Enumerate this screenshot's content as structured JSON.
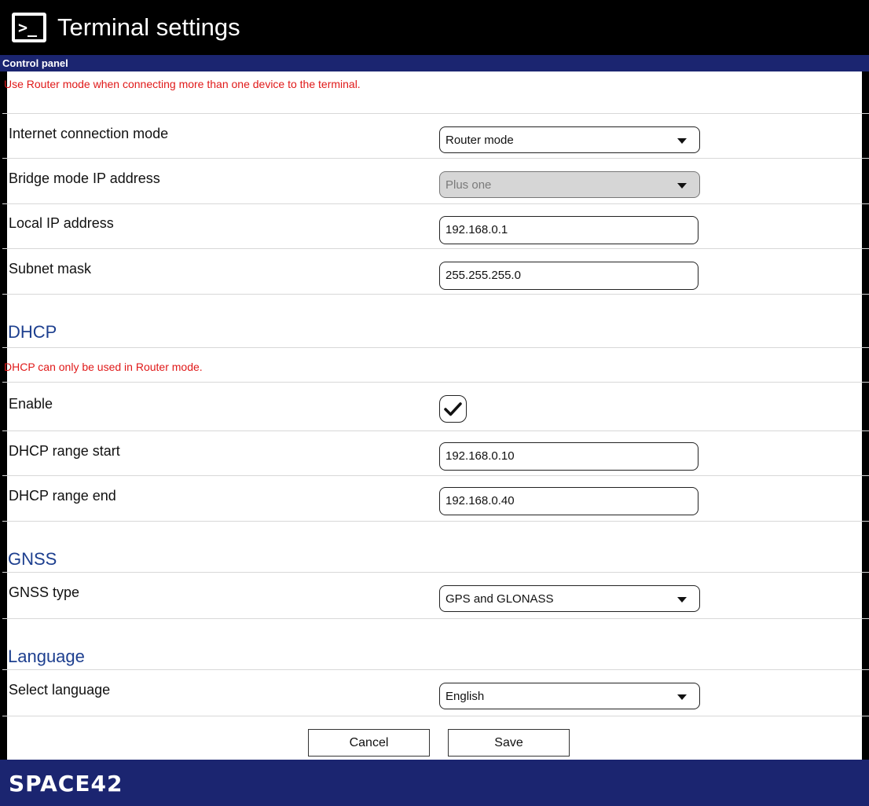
{
  "window": {
    "title": "Terminal settings",
    "icon": "terminal-icon"
  },
  "breadcrumb": "Control panel",
  "network": {
    "notice": "Use Router mode when connecting more than one device to the terminal.",
    "internet_mode": {
      "label": "Internet connection mode",
      "value": "Router mode"
    },
    "bridge_ip": {
      "label": "Bridge mode IP address",
      "value": "Plus one",
      "disabled": true
    },
    "local_ip": {
      "label": "Local IP address",
      "value": "192.168.0.1"
    },
    "subnet": {
      "label": "Subnet mask",
      "value": "255.255.255.0"
    }
  },
  "dhcp": {
    "title": "DHCP",
    "notice": "DHCP can only be used in Router mode.",
    "enable": {
      "label": "Enable",
      "checked": true
    },
    "range_start": {
      "label": "DHCP range start",
      "value": "192.168.0.10"
    },
    "range_end": {
      "label": "DHCP range end",
      "value": "192.168.0.40"
    }
  },
  "gnss": {
    "title": "GNSS",
    "type": {
      "label": "GNSS type",
      "value": "GPS and GLONASS"
    }
  },
  "language": {
    "title": "Language",
    "select": {
      "label": "Select language",
      "value": "English"
    }
  },
  "actions": {
    "cancel": "Cancel",
    "save": "Save"
  },
  "footer": {
    "brand": "SPACE42"
  },
  "colors": {
    "titlebar": "#000000",
    "navbar": "#1b2570",
    "notice": "#e01919",
    "section": "#1d3f8f"
  }
}
